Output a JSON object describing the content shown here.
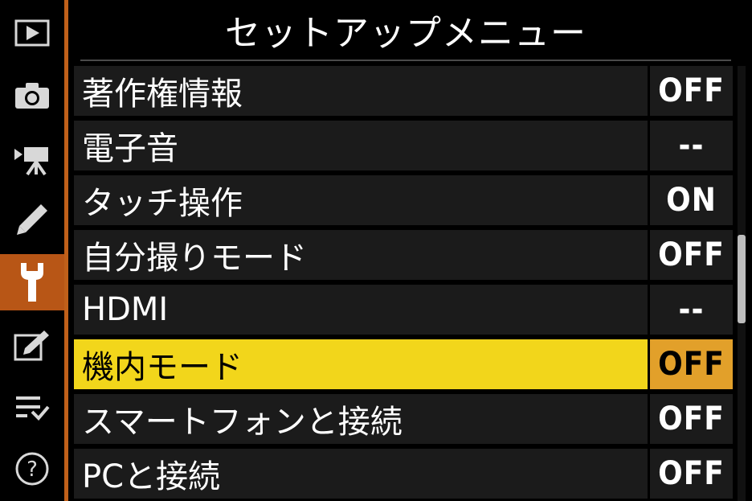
{
  "title": "セットアップメニュー",
  "tabs": [
    {
      "icon": "playback-icon",
      "active": false
    },
    {
      "icon": "camera-icon",
      "active": false
    },
    {
      "icon": "movie-camera-icon",
      "active": false
    },
    {
      "icon": "pencil-icon",
      "active": false
    },
    {
      "icon": "wrench-icon",
      "active": true
    },
    {
      "icon": "retouch-icon",
      "active": false
    },
    {
      "icon": "my-menu-icon",
      "active": false
    },
    {
      "icon": "help-icon",
      "active": false,
      "glyph": "?"
    }
  ],
  "items": [
    {
      "label": "著作権情報",
      "value": "OFF"
    },
    {
      "label": "電子音",
      "value": "--"
    },
    {
      "label": "タッチ操作",
      "value": "ON"
    },
    {
      "label": "自分撮りモード",
      "value": "OFF"
    },
    {
      "label": "HDMI",
      "value": "--"
    },
    {
      "label": "機内モード",
      "value": "OFF",
      "selected": true
    },
    {
      "label": "スマートフォンと接続",
      "value": "OFF"
    },
    {
      "label": "PCと接続",
      "value": "OFF"
    }
  ],
  "colors": {
    "accent_tab": "#b85616",
    "selected_row": "#f2d61b",
    "selected_value": "#e2a02a",
    "row_background": "#1b1b1b"
  }
}
